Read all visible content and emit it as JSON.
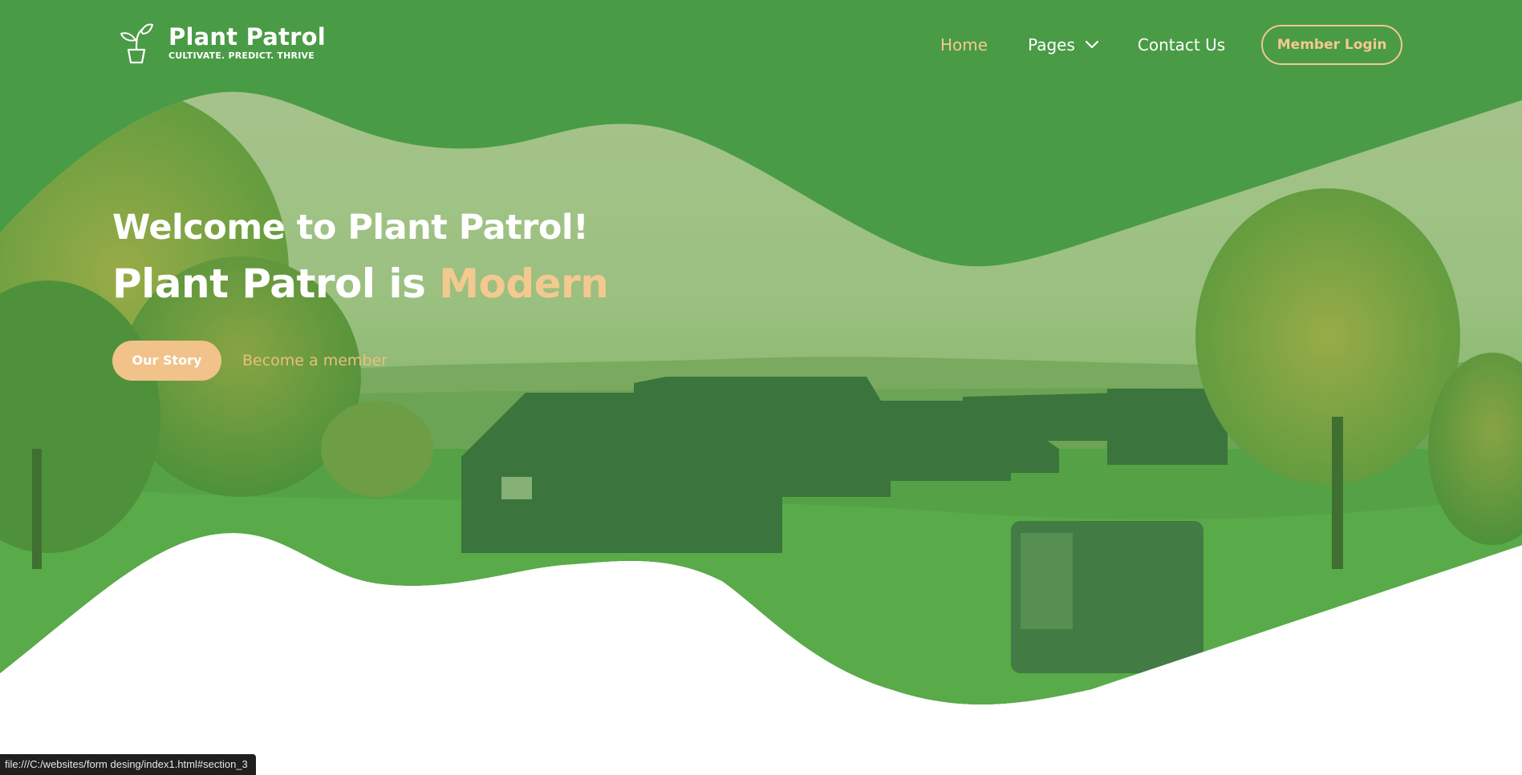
{
  "brand": {
    "name": "Plant Patrol",
    "tagline": "CULTIVATE. PREDICT. THRIVE",
    "icon": "sprout-pot-icon"
  },
  "nav": {
    "home": "Home",
    "pages": "Pages",
    "contact": "Contact Us",
    "login": "Member Login"
  },
  "hero": {
    "welcome": "Welcome to Plant Patrol!",
    "line2_prefix": "Plant Patrol is ",
    "line2_accent": "Modern",
    "primary_button": "Our Story",
    "secondary_link": "Become a member",
    "background_image": "golf-course-landscape"
  },
  "status_bar": {
    "url": "file:///C:/websites/form desing/index1.html#section_3"
  },
  "colors": {
    "primary_green": "#4a9b45",
    "accent": "#f4c98f",
    "white": "#ffffff"
  }
}
